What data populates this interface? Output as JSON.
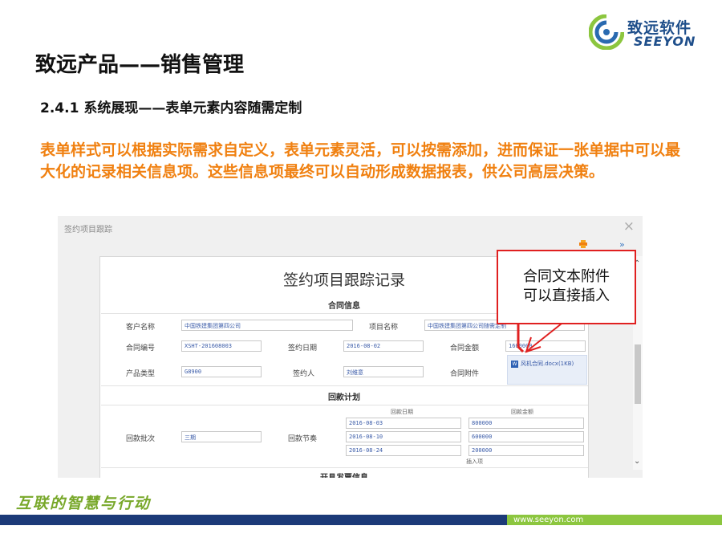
{
  "brand": {
    "name_cn": "致远软件",
    "name_en": "SEEYON",
    "slogan": "互联的智慧与行动",
    "url": "www.seeyon.com"
  },
  "colors": {
    "highlight": "#f08010",
    "callout_border": "#e02020",
    "brand_blue": "#1c3a78",
    "brand_green": "#8cc63f"
  },
  "slide": {
    "title": "致远产品——销售管理",
    "subtitle": "2.4.1 系统展现——表单元素内容随需定制",
    "description": "表单样式可以根据实际需求自定义，表单元素灵活，可以按需添加，进而保证一张单据中可以最大化的记录相关信息项。这些信息项最终可以自动形成数据报表，供公司高层决策。"
  },
  "window": {
    "title": "签约项目跟踪",
    "close_icon": "×",
    "expand_icon": "»",
    "form": {
      "title": "签约项目跟踪记录",
      "section_contract": "合同信息",
      "customer_label": "客户名称",
      "customer_value": "中国铁建集团第四公司",
      "project_label": "项目名称",
      "project_value": "中国铁建集团第四公司随需定制",
      "contract_no_label": "合同编号",
      "contract_no_value": "XSHT-201608003",
      "sign_date_label": "签约日期",
      "sign_date_value": "2016-08-02",
      "amount_label": "合同金额",
      "amount_value": "1600000",
      "product_label": "产品类型",
      "product_value": "G8900",
      "signer_label": "签约人",
      "signer_value": "刘维意",
      "attachment_label": "合同附件",
      "attachment_value": "风机合同.docx(1KB)",
      "section_payment": "回款计划",
      "batch_label": "回款批次",
      "batch_value": "三期",
      "schedule_label": "回款节奏",
      "pay_date_header": "回款日期",
      "pay_amount_header": "回款金额",
      "payments": [
        {
          "date": "2016-08-03",
          "amount": "800000"
        },
        {
          "date": "2016-08-10",
          "amount": "600000"
        },
        {
          "date": "2016-08-24",
          "amount": "200000"
        }
      ],
      "insert_label": "插入项",
      "section_invoice": "开具发票信息"
    }
  },
  "callout": {
    "line1": "合同文本附件",
    "line2": "可以直接插入"
  }
}
